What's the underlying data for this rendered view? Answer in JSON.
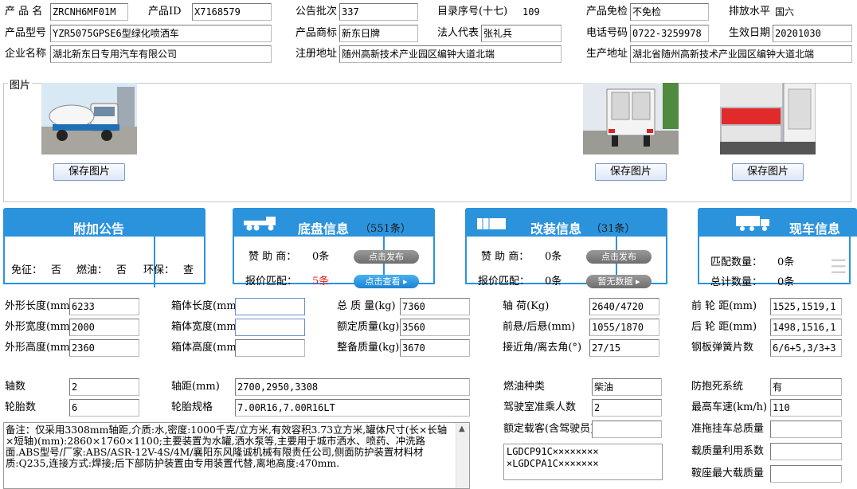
{
  "top": {
    "product_name_label": "产 品 名",
    "product_name": "ZRCNH6MF01M",
    "product_id_label": "产品ID",
    "product_id": "X7168579",
    "batch_label": "公告批次",
    "batch": "337",
    "catalog_label": "目录序号(十七)",
    "catalog": "109",
    "exempt_label": "产品免检",
    "exempt": "不免检",
    "emission_label": "排放水平",
    "emission": "国六",
    "model_label": "产品型号",
    "model": "YZR5075GPSE6型绿化喷洒车",
    "brand_label": "产品商标",
    "brand": "新东日牌",
    "legal_label": "法人代表",
    "legal": "张礼兵",
    "phone_label": "电话号码",
    "phone": "0722-3259978",
    "effective_label": "生效日期",
    "effective": "20201030",
    "company_label": "企业名称",
    "company": "湖北新东日专用汽车有限公司",
    "reg_addr_label": "注册地址",
    "reg_addr": "随州高新技术产业园区编钟大道北端",
    "prod_addr_label": "生产地址",
    "prod_addr": "湖北省随州高新技术产业园区编钟大道北端"
  },
  "photos": {
    "label": "图片",
    "save_label": "保存图片"
  },
  "panels": {
    "notice": {
      "title": "附加公告",
      "exempt_label": "免征：",
      "exempt": "否",
      "fuel_label": "燃油：",
      "fuel": "否",
      "env_label": "环保：",
      "env": "查"
    },
    "chassis": {
      "title": "底盘信息",
      "count": "（551条）",
      "sponsor_label": "赞 助 商：",
      "sponsor": "0条",
      "sponsor_btn": "点击发布",
      "quote_label": "报价匹配：",
      "quote": "5条",
      "quote_btn": "点击查看 ▸"
    },
    "mod": {
      "title": "改装信息",
      "count": "（31条）",
      "sponsor_label": "赞 助 商：",
      "sponsor": "0条",
      "sponsor_btn": "点击发布",
      "quote_label": "报价匹配：",
      "quote": "0条",
      "quote_btn": "暂无数据 ▸"
    },
    "stock": {
      "title": "现车信息",
      "match_label": "匹配数量：",
      "match": "0条",
      "total_label": "总计数量：",
      "total": "0条"
    }
  },
  "specs": {
    "len_label": "外形长度(mm)",
    "len": "6233",
    "wid_label": "外形宽度(mm)",
    "wid": "2000",
    "hei_label": "外形高度(mm)",
    "hei": "2360",
    "box_len_label": "箱体长度(mm)",
    "box_len": "",
    "box_wid_label": "箱体宽度(mm)",
    "box_wid": "",
    "box_hei_label": "箱体高度(mm)",
    "box_hei": "",
    "total_mass_label": "总 质 量(kg)",
    "total_mass": "7360",
    "rated_mass_label": "额定质量(kg)",
    "rated_mass": "3560",
    "curb_mass_label": "整备质量(kg)",
    "curb_mass": "3670",
    "axle_load_label": "轴 荷(Kg)",
    "axle_load": "2640/4720",
    "overhang_label": "前悬/后悬(mm)",
    "overhang": "1055/1870",
    "angle_label": "接近角/离去角(°)",
    "angle": "27/15",
    "front_track_label": "前 轮 距(mm)",
    "front_track": "1525,1519,1",
    "rear_track_label": "后 轮 距(mm)",
    "rear_track": "1498,1516,1",
    "spring_label": "钢板弹簧片数",
    "spring": "6/6+5,3/3+3",
    "axles_label": "轴数",
    "axles": "2",
    "wheelbase_label": "轴距(mm)",
    "wheelbase": "2700,2950,3308",
    "fuel_type_label": "燃油种类",
    "fuel_type": "柴油",
    "abs_label": "防抱死系统",
    "abs": "有",
    "tires_label": "轮胎数",
    "tires": "6",
    "tire_spec_label": "轮胎规格",
    "tire_spec": "7.00R16,7.00R16LT",
    "cab_label": "驾驶室准乘人数",
    "cab": "2",
    "speed_label": "最高车速(km/h)",
    "speed": "110",
    "cargo_label": "额定载客(含驾驶员)",
    "cargo": "",
    "trailer_label": "准拖挂车总质量",
    "trailer": "",
    "util_label": "载质量利用系数",
    "util": "",
    "saddle_label": "鞍座最大载质量",
    "saddle": "",
    "vin1": "LGDCP91C××××××××",
    "vin2": "×LGDCPA1C×××××××",
    "notes": "备注：仅采用3308mm轴距,介质:水,密度:1000千克/立方米,有效容积3.73立方米,罐体尺寸(长×长轴×短轴)(mm):2860×1760×1100;主要装置为水罐,洒水泵等,主要用于城市洒水、喷药、冲洗路面.ABS型号/厂家:ABS/ASR-12V-4S/4M/襄阳东风隆诚机械有限责任公司,侧面防护装置材料材质:Q235,连接方式:焊接;后下部防护装置由专用装置代替,离地高度:470mm."
  }
}
